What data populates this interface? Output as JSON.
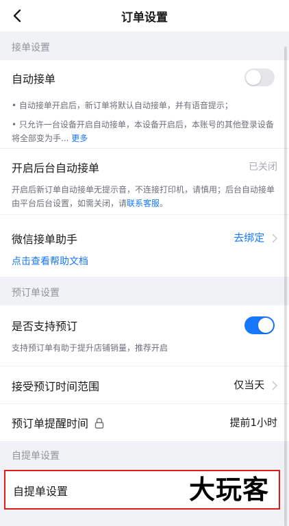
{
  "header": {
    "title": "订单设置"
  },
  "section_accept": {
    "label": "接单设置"
  },
  "auto_accept": {
    "title": "自动接单",
    "toggle": "off",
    "note1": "• 自动接单开启后，新订单将默认自动接单，并有语音提示；",
    "note2": "• 只允许一台设备开启自动接单，本设备开启后，本账号的其他登录设备将全部变为手...",
    "note2_link": "更多"
  },
  "background_accept": {
    "title": "开启后台自动接单",
    "status": "已关闭",
    "note": "开启后新订单自动接单无提示音，不连接打印机，请慎用；后台自动接单由平台后台设置，如需关闭，请",
    "note_link": "联系客服",
    "note_end": "。"
  },
  "wechat_helper": {
    "title": "微信接单助手",
    "action": "去绑定",
    "help_link": "点击查看帮助文档"
  },
  "section_preorder": {
    "label": "预订单设置"
  },
  "support_preorder": {
    "title": "是否支持预订",
    "toggle": "on",
    "note": "支持预订单有助于提升店铺销量，推荐开启"
  },
  "preorder_range": {
    "title": "接受预订时间范围",
    "value": "仅当天"
  },
  "preorder_reminder": {
    "title": "预订单提醒时间",
    "value": "提前1小时"
  },
  "section_pickup": {
    "label": "自提单设置"
  },
  "pickup_settings": {
    "title": "自提单设置"
  },
  "watermark": "大玩客",
  "colors": {
    "accent": "#1677ff",
    "highlight": "#e01a1a",
    "toggle_off": "#e4e6ea"
  }
}
